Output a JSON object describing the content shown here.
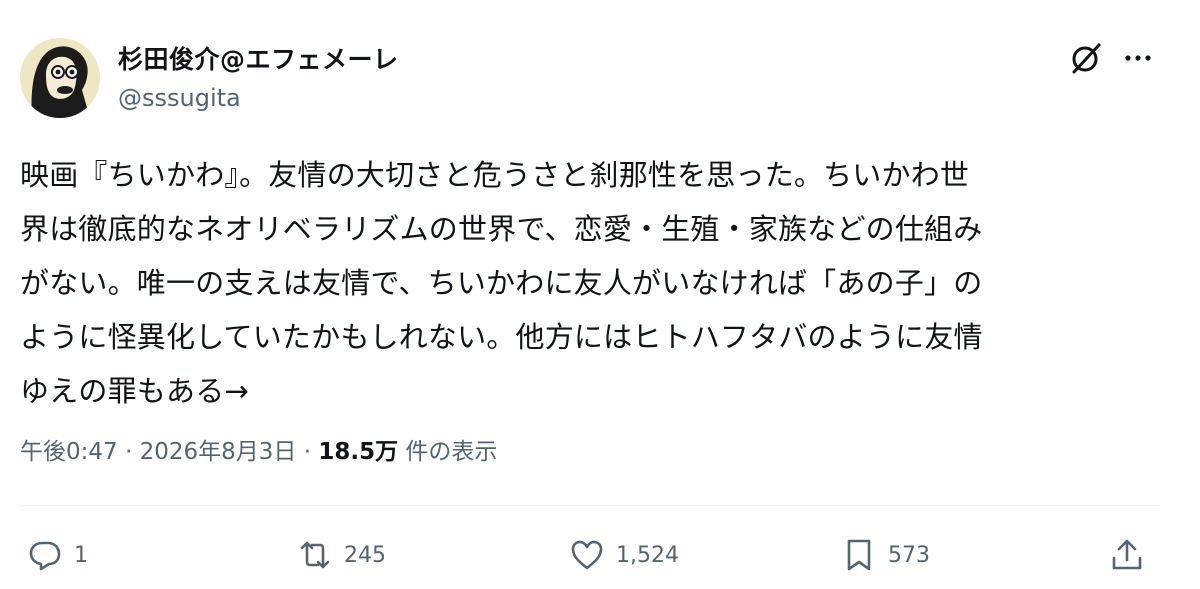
{
  "author": {
    "display_name": "杉田俊介@エフェメーレ",
    "handle": "@sssugita"
  },
  "tweet": {
    "lines": [
      "映画『ちいかわ』。友情の大切さと危うさと刹那性を思った。ちいかわ世",
      "界は徹底的なネオリベラリズムの世界で、恋愛・生殖・家族などの仕組み",
      "がない。唯一の支えは友情で、ちいかわに友人がいなければ「あの子」の",
      "ように怪異化していたかもしれない。他方にはヒトハフタバのように友情",
      "ゆえの罪もある→"
    ]
  },
  "meta": {
    "time": "午後0:47",
    "sep1": " · ",
    "date": "2026年8月3日",
    "sep2": " · ",
    "views": "18.5万",
    "views_label": " 件の表示"
  },
  "actions": {
    "replies": "1",
    "reposts": "245",
    "likes": "1,524",
    "bookmarks": "573"
  },
  "icons": {
    "grok": "grok-icon",
    "more": "more-icon",
    "reply": "reply-icon",
    "repost": "repost-icon",
    "like": "heart-icon",
    "bookmark": "bookmark-icon",
    "share": "share-icon"
  },
  "colors": {
    "text": "#0f1419",
    "secondary": "#536471",
    "divider": "#eff3f4"
  }
}
